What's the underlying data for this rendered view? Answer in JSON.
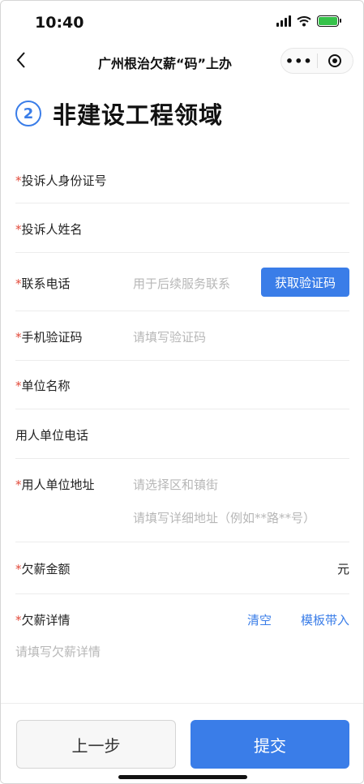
{
  "status_bar": {
    "time": "10:40"
  },
  "nav": {
    "title": "广州根治欠薪“码”上办",
    "more_label": "•••"
  },
  "section": {
    "step_number": "2",
    "title": "非建设工程领域"
  },
  "form": {
    "required_mark": "*",
    "id_number": {
      "label": "投诉人身份证号"
    },
    "name": {
      "label": "投诉人姓名"
    },
    "phone": {
      "label": "联系电话",
      "placeholder": "用于后续服务联系",
      "code_button": "获取验证码"
    },
    "sms_code": {
      "label": "手机验证码",
      "placeholder": "请填写验证码"
    },
    "company_name": {
      "label": "单位名称"
    },
    "employer_phone": {
      "label": "用人单位电话"
    },
    "employer_address": {
      "label": "用人单位地址",
      "district_placeholder": "请选择区和镇街",
      "detail_placeholder": "请填写详细地址（例如**路**号）"
    },
    "amount": {
      "label": "欠薪金额",
      "unit": "元"
    },
    "details": {
      "label": "欠薪详情",
      "clear_label": "清空",
      "template_label": "模板带入",
      "placeholder": "请填写欠薪详情"
    }
  },
  "footer": {
    "prev_label": "上一步",
    "submit_label": "提交"
  },
  "colors": {
    "accent": "#3a7de8",
    "required": "#e24a3b"
  }
}
